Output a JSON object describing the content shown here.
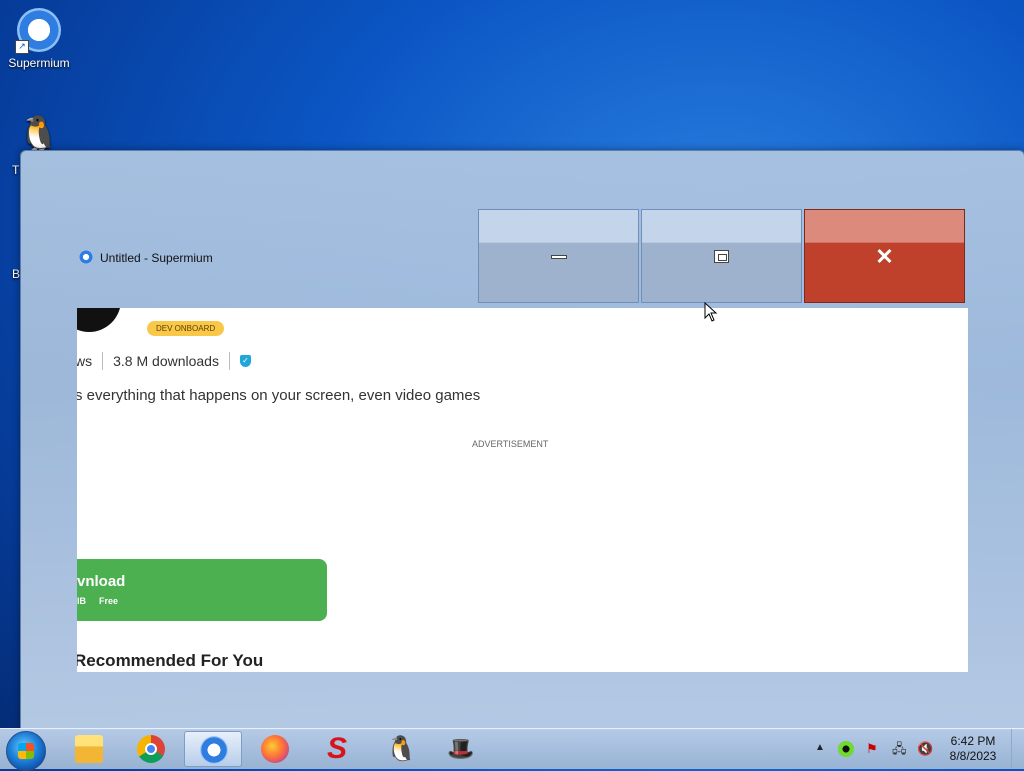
{
  "desktop": {
    "icons": [
      {
        "label": "Supermium",
        "icon": "supermium-icon"
      },
      {
        "label": "T",
        "icon": "penguin-icon"
      },
      {
        "label": "B",
        "icon": "app-icon"
      }
    ]
  },
  "window": {
    "title": "Untitled - Supermium",
    "controls": {
      "minimize": "minimize-icon",
      "maximize": "maximize-icon",
      "close": "✕"
    },
    "content": {
      "dev_badge": "DEV ONBOARD",
      "stats": {
        "reviews_fragment": "ws",
        "downloads": "3.8 M downloads",
        "verified_icon": "✓"
      },
      "description": "s everything that happens on your screen, even video games",
      "ad_label": "ADVERTISEMENT",
      "download": {
        "title": "vnload",
        "size": "IB",
        "price": "Free"
      },
      "recommended": "Recommended For You"
    }
  },
  "taskbar": {
    "start_icon": "windows-start-icon",
    "items": [
      {
        "name": "file-explorer",
        "icon": "folder-icon"
      },
      {
        "name": "chrome",
        "icon": "chrome-icon"
      },
      {
        "name": "supermium",
        "icon": "supermium-icon",
        "active": true
      },
      {
        "name": "firefox",
        "icon": "firefox-icon"
      },
      {
        "name": "s-app",
        "icon": "S"
      },
      {
        "name": "penguin-app",
        "icon": "🐧"
      },
      {
        "name": "hat-app",
        "icon": "🎩"
      }
    ],
    "tray": {
      "expand": "▲",
      "flag": "⚑",
      "network": "🖧",
      "volume": "🔇",
      "time": "6:42 PM",
      "date": "8/8/2023"
    }
  }
}
